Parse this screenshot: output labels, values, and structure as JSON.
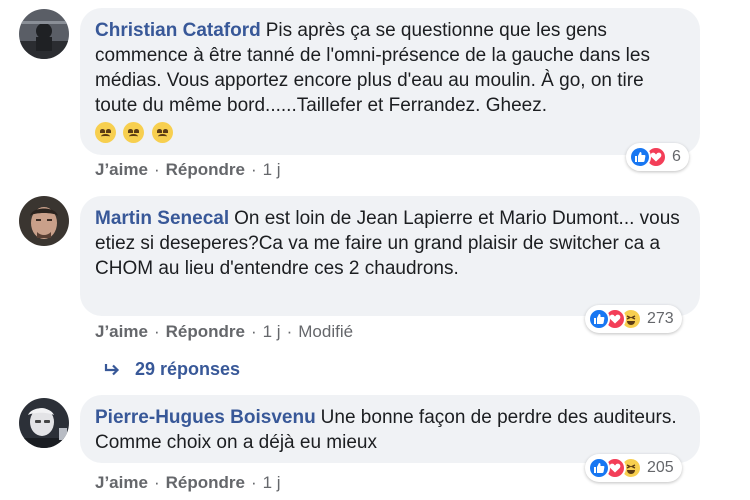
{
  "comments": [
    {
      "author": "Christian Cataford",
      "text": "Pis après ça se questionne que les gens commence à être tanné de l'omni-présence de la gauche dans les médias. Vous apportez encore plus d'eau au moulin. À go, on tire toute du même bord......Taillefer et Ferrandez. Gheez.",
      "like_label": "J’aime",
      "reply_label": "Répondre",
      "time": "1 j",
      "reaction_count": "6"
    },
    {
      "author": "Martin Senecal",
      "text": "On est loin de Jean Lapierre et Mario Dumont... vous etiez si deseperes?Ca va me faire un grand plaisir de switcher ca a CHOM au lieu d'entendre ces 2 chaudrons.",
      "like_label": "J’aime",
      "reply_label": "Répondre",
      "time": "1 j",
      "edited": "Modifié",
      "reaction_count": "273"
    },
    {
      "author": "Pierre-Hugues Boisvenu",
      "text": "Une bonne façon de perdre des auditeurs. Comme choix on a déjà eu mieux",
      "like_label": "J’aime",
      "reply_label": "Répondre",
      "time": "1 j",
      "reaction_count": "205"
    }
  ],
  "replies_link": "29 réponses",
  "colors": {
    "link": "#385898",
    "bubble": "#f0f2f5",
    "meta": "#65676b",
    "like": "#1877f2",
    "love": "#f33e58",
    "haha": "#f7cf4f"
  }
}
